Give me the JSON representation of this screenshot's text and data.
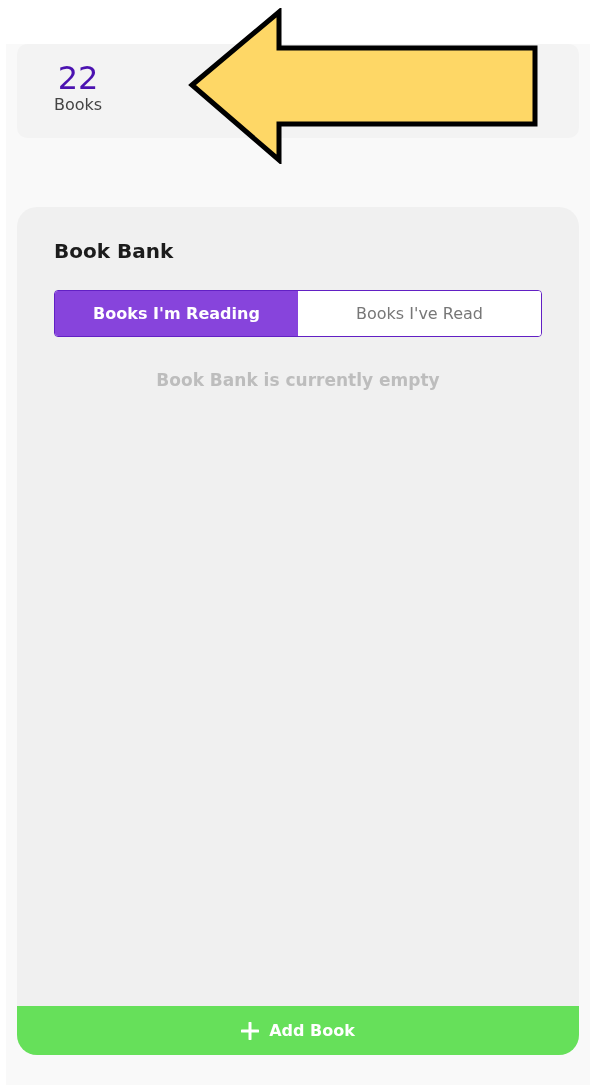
{
  "stats": {
    "count": "22",
    "label": "Books"
  },
  "book_bank": {
    "title": "Book Bank",
    "tabs": [
      {
        "label": "Books I'm Reading",
        "selected": true
      },
      {
        "label": "Books I've Read",
        "selected": false
      }
    ],
    "empty_message": "Book Bank is currently empty",
    "add_button": {
      "label": "Add Book"
    }
  }
}
